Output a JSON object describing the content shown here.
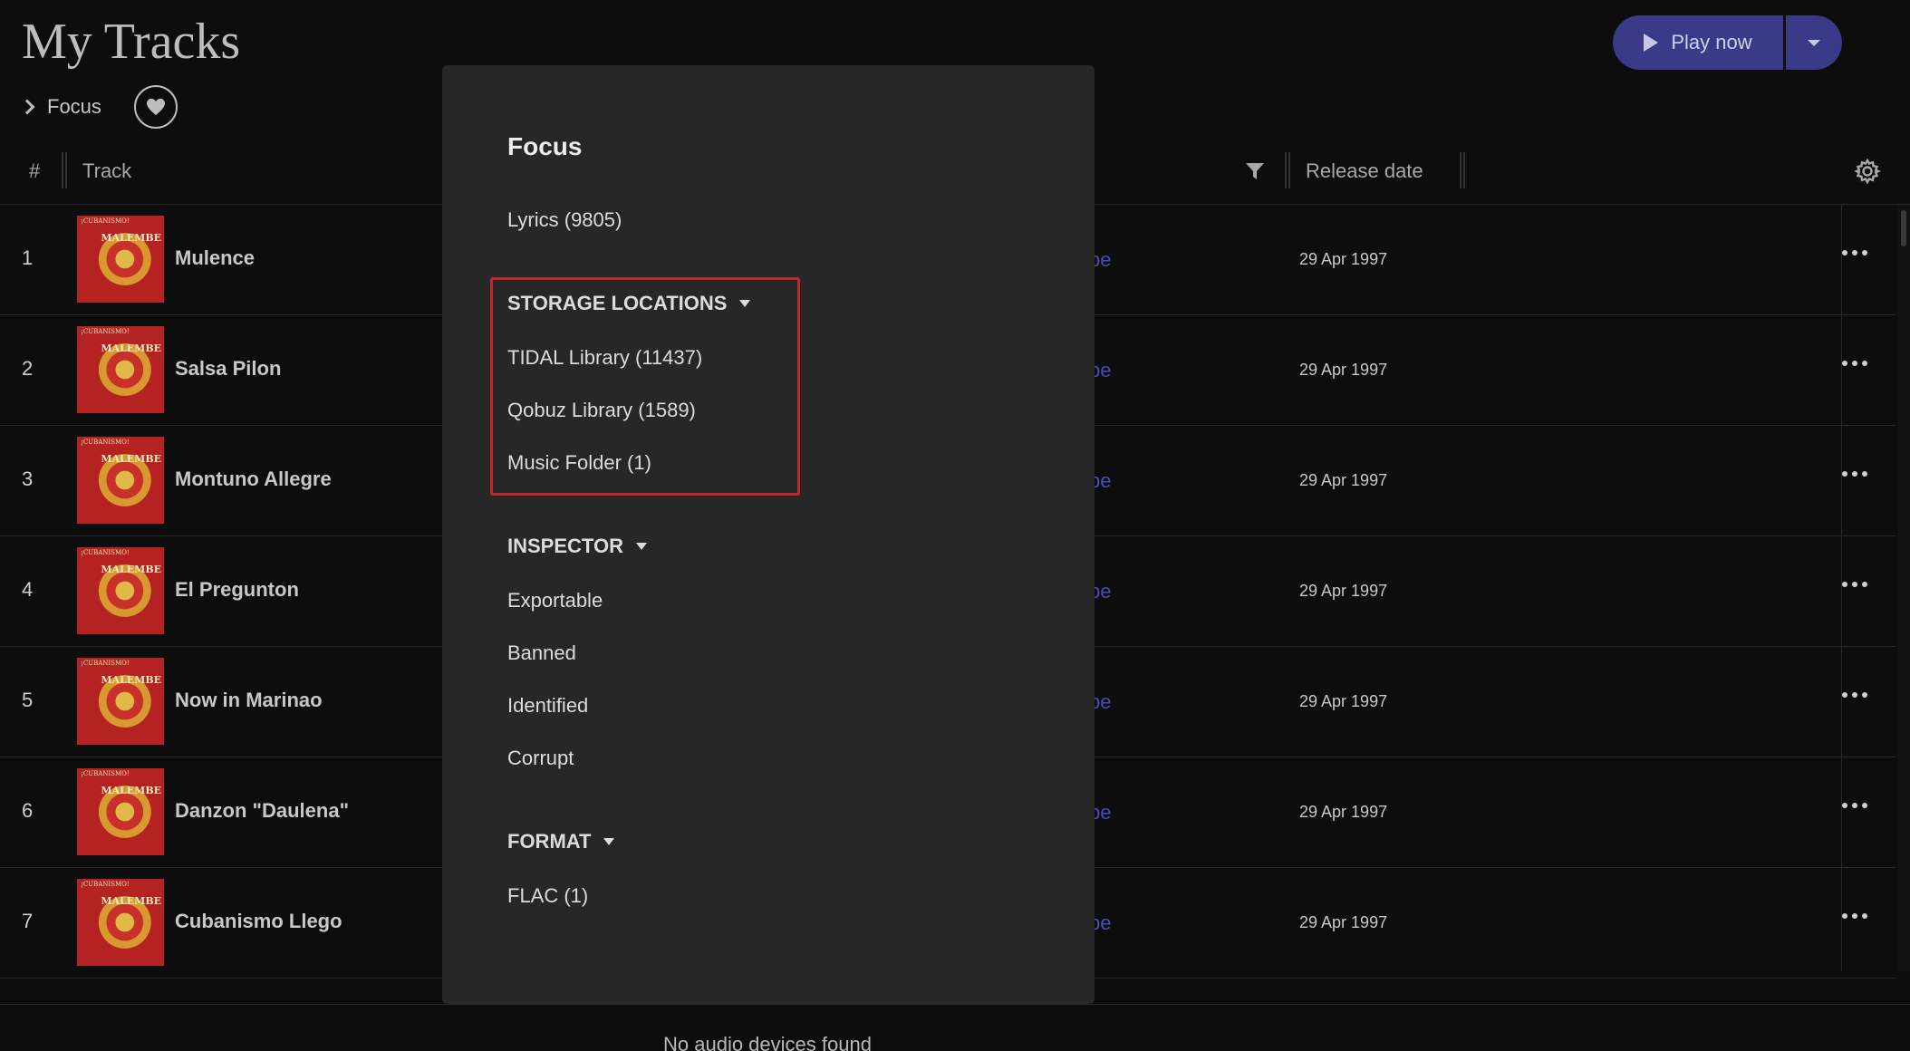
{
  "header": {
    "title": "My Tracks",
    "focus_label": "Focus",
    "play_label": "Play now"
  },
  "columns": {
    "number": "#",
    "track": "Track",
    "release_date": "Release date"
  },
  "tracks": [
    {
      "num": "1",
      "title": "Mulence",
      "link": "be",
      "date": "29 Apr 1997"
    },
    {
      "num": "2",
      "title": "Salsa Pilon",
      "link": "be",
      "date": "29 Apr 1997"
    },
    {
      "num": "3",
      "title": "Montuno Allegre",
      "link": "be",
      "date": "29 Apr 1997"
    },
    {
      "num": "4",
      "title": "El Pregunton",
      "link": "be",
      "date": "29 Apr 1997"
    },
    {
      "num": "5",
      "title": "Now in Marinao",
      "link": "be",
      "date": "29 Apr 1997"
    },
    {
      "num": "6",
      "title": "Danzon \"Daulena\"",
      "link": "be",
      "date": "29 Apr 1997"
    },
    {
      "num": "7",
      "title": "Cubanismo Llego",
      "link": "be",
      "date": "29 Apr 1997"
    }
  ],
  "album_art": {
    "top_text": "¡CUBANISMO!",
    "name_text": "MALEMBE"
  },
  "focus_panel": {
    "title": "Focus",
    "lyrics": "Lyrics (9805)",
    "storage_header": "STORAGE LOCATIONS",
    "storage_items": [
      "TIDAL Library (11437)",
      "Qobuz Library (1589)",
      "Music Folder (1)"
    ],
    "inspector_header": "INSPECTOR",
    "inspector_items": [
      "Exportable",
      "Banned",
      "Identified",
      "Corrupt"
    ],
    "format_header": "FORMAT",
    "format_items": [
      "FLAC (1)"
    ]
  },
  "footer": {
    "status": "No audio devices found"
  },
  "colors": {
    "accent": "#3a3a88",
    "highlight": "#c0282e",
    "link": "#4a4ab8"
  }
}
